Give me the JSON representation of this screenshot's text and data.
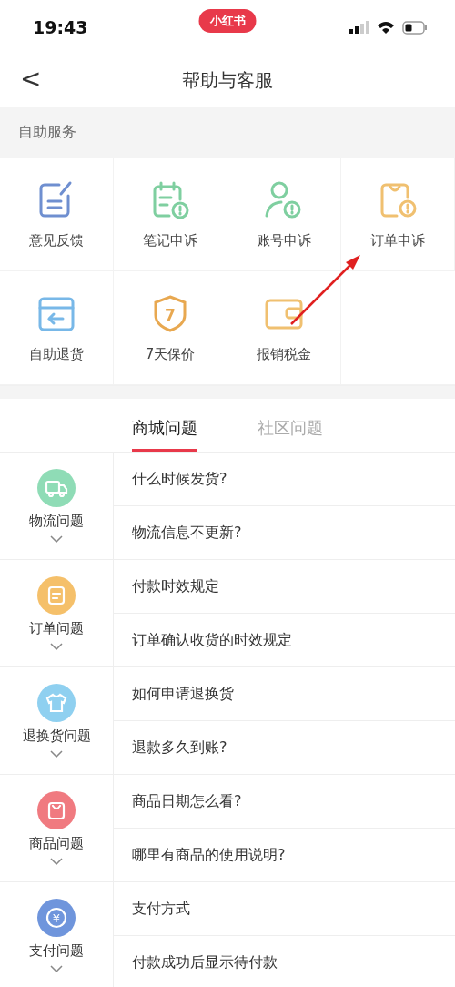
{
  "status_bar": {
    "time": "19:43",
    "app_badge": "小红书"
  },
  "header": {
    "back": "<",
    "title": "帮助与客服"
  },
  "self_service": {
    "label": "自助服务",
    "items": [
      {
        "label": "意见反馈",
        "kind": "feedback",
        "color": "#6f8fd0"
      },
      {
        "label": "笔记申诉",
        "kind": "note",
        "color": "#7fcfa0"
      },
      {
        "label": "账号申诉",
        "kind": "account",
        "color": "#7fcfa0"
      },
      {
        "label": "订单申诉",
        "kind": "bag",
        "color": "#f0c070"
      },
      {
        "label": "自助退货",
        "kind": "return",
        "color": "#78b8e8"
      },
      {
        "label": "7天保价",
        "kind": "shield",
        "color": "#e8a850",
        "badge": "7"
      },
      {
        "label": "报销税金",
        "kind": "wallet",
        "color": "#f0c070"
      }
    ]
  },
  "tabs": [
    {
      "label": "商城问题",
      "selected": true
    },
    {
      "label": "社区问题",
      "selected": false
    }
  ],
  "categories": [
    {
      "name": "物流问题",
      "kind": "truck",
      "color": "#8fdcb6",
      "questions": [
        "什么时候发货?",
        "物流信息不更新?"
      ]
    },
    {
      "name": "订单问题",
      "kind": "list",
      "color": "#f5c06a",
      "questions": [
        "付款时效规定",
        "订单确认收货的时效规定"
      ]
    },
    {
      "name": "退换货问题",
      "kind": "shirt",
      "color": "#8fd0f0",
      "questions": [
        "如何申请退换货",
        "退款多久到账?"
      ]
    },
    {
      "name": "商品问题",
      "kind": "bag",
      "color": "#f07a80",
      "questions": [
        "商品日期怎么看?",
        "哪里有商品的使用说明?"
      ]
    },
    {
      "name": "支付问题",
      "kind": "yen",
      "color": "#6f95dc",
      "symbol": "¥",
      "questions": [
        "支付方式",
        "付款成功后显示待付款"
      ]
    }
  ]
}
